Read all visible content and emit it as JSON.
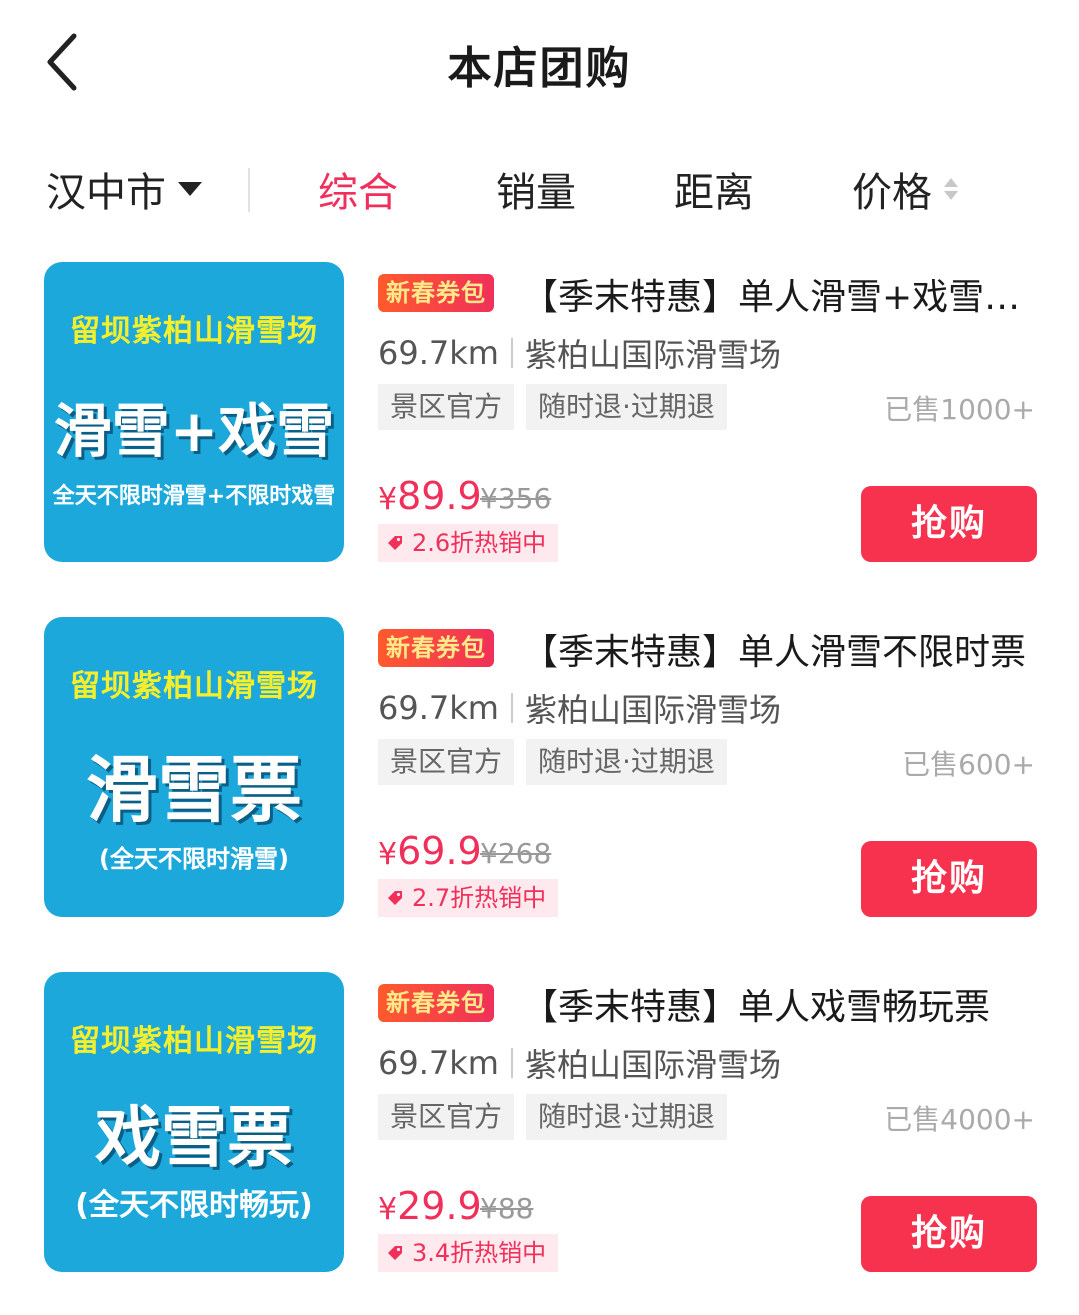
{
  "header": {
    "title": "本店团购"
  },
  "filter": {
    "city": "汉中市",
    "tabs": [
      "综合",
      "销量",
      "距离",
      "价格"
    ],
    "active_tab": "综合"
  },
  "colors": {
    "accent": "#f0305a",
    "thumb_bg": "#1da8dc"
  },
  "products": [
    {
      "thumb_top": "留坝紫柏山滑雪场",
      "thumb_main": "滑雪+戏雪",
      "thumb_sub": "全天不限时滑雪+不限时戏雪",
      "badge": "新春券包",
      "title": "【季末特惠】单人滑雪+戏雪畅玩票",
      "distance": "69.7km",
      "venue": "紫柏山国际滑雪场",
      "tag1": "景区官方",
      "tag2": "随时退·过期退",
      "sold": "已售1000+",
      "price_symbol": "¥",
      "price": "89.9",
      "original": "¥356",
      "discount": "2.6折热销中",
      "buy": "抢购"
    },
    {
      "thumb_top": "留坝紫柏山滑雪场",
      "thumb_main": "滑雪票",
      "thumb_sub": "(全天不限时滑雪)",
      "badge": "新春券包",
      "title": "【季末特惠】单人滑雪不限时票",
      "distance": "69.7km",
      "venue": "紫柏山国际滑雪场",
      "tag1": "景区官方",
      "tag2": "随时退·过期退",
      "sold": "已售600+",
      "price_symbol": "¥",
      "price": "69.9",
      "original": "¥268",
      "discount": "2.7折热销中",
      "buy": "抢购"
    },
    {
      "thumb_top": "留坝紫柏山滑雪场",
      "thumb_main": "戏雪票",
      "thumb_sub": "(全天不限时畅玩)",
      "badge": "新春券包",
      "title": "【季末特惠】单人戏雪畅玩票",
      "distance": "69.7km",
      "venue": "紫柏山国际滑雪场",
      "tag1": "景区官方",
      "tag2": "随时退·过期退",
      "sold": "已售4000+",
      "price_symbol": "¥",
      "price": "29.9",
      "original": "¥88",
      "discount": "3.4折热销中",
      "buy": "抢购"
    }
  ]
}
